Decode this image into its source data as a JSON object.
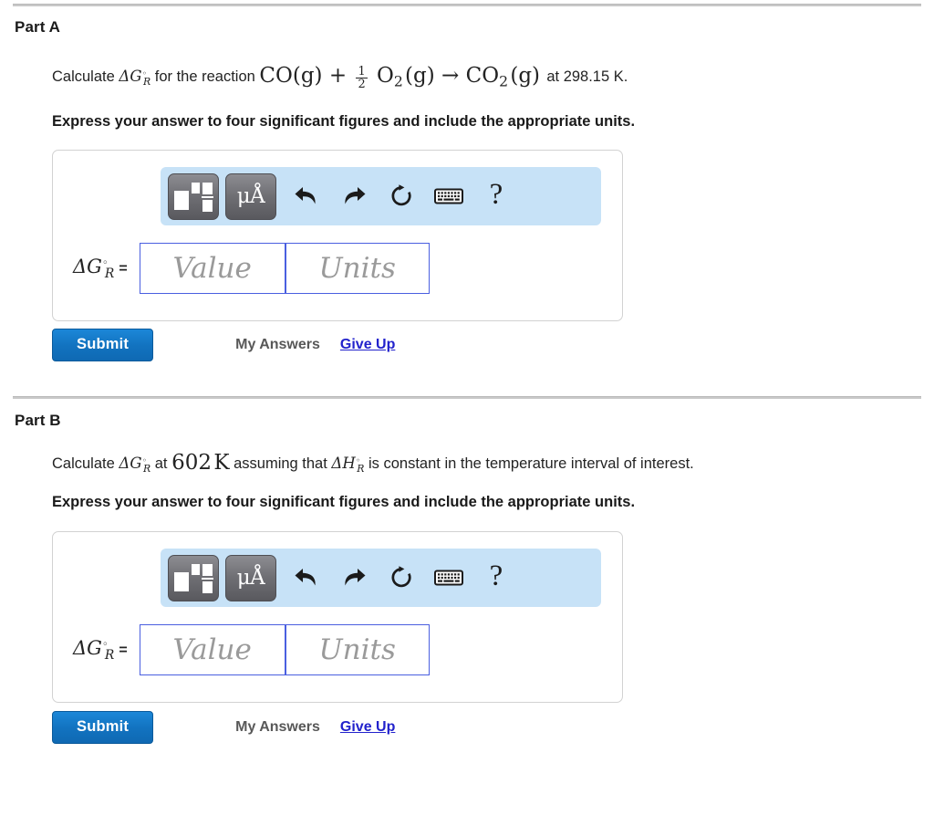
{
  "separators": {
    "count": 2,
    "color": "#c9c9c9"
  },
  "parts": [
    {
      "heading": "Part A",
      "question_prefix": "Calculate",
      "question_symbol_G": "ΔG",
      "question_mid": "for the reaction",
      "reaction": "CO(g) + 1/2 O2(g) → CO2(g)",
      "reaction_species_1": "CO",
      "reaction_state_1": "(g)",
      "plus": "+",
      "fraction_numerator": "1",
      "fraction_denominator": "2",
      "reaction_species_2": "O",
      "reaction_subscript_2": "2",
      "reaction_state_2": "(g)",
      "arrow": "→",
      "reaction_species_3": "CO",
      "reaction_subscript_3": "2",
      "reaction_state_3": "(g)",
      "question_suffix": "at 298.15 K.",
      "temperature": "298.15",
      "temperature_unit": "K",
      "instruction": "Express your answer to four significant figures and include the appropriate units.",
      "answer_label_main": "ΔG",
      "answer_label_degree": "◦",
      "answer_label_sub": "R",
      "answer_label_equals": "=",
      "value_placeholder": "Value",
      "units_placeholder": "Units",
      "value_current": "",
      "units_current": "",
      "submit_label": "Submit",
      "my_answers_label": "My Answers",
      "give_up_label": "Give Up"
    },
    {
      "heading": "Part B",
      "question_prefix": "Calculate",
      "question_symbol_G": "ΔG",
      "question_at": "at",
      "temperature": "602",
      "temperature_unit": "K",
      "question_assuming": "assuming that",
      "question_symbol_H": "ΔH",
      "question_tail": "is constant in the temperature interval of interest.",
      "instruction": "Express your answer to four significant figures and include the appropriate units.",
      "answer_label_main": "ΔG",
      "answer_label_degree": "◦",
      "answer_label_sub": "R",
      "answer_label_equals": "=",
      "value_placeholder": "Value",
      "units_placeholder": "Units",
      "value_current": "",
      "units_current": "",
      "submit_label": "Submit",
      "my_answers_label": "My Answers",
      "give_up_label": "Give Up"
    }
  ],
  "toolbar": {
    "background_color": "#c7e2f7",
    "buttons": [
      {
        "name": "template-icon",
        "label": ""
      },
      {
        "name": "greek-units-icon",
        "label": "μÅ"
      },
      {
        "name": "undo-icon",
        "label": ""
      },
      {
        "name": "redo-icon",
        "label": ""
      },
      {
        "name": "reset-icon",
        "label": ""
      },
      {
        "name": "keyboard-icon",
        "label": ""
      },
      {
        "name": "help-icon",
        "label": "?"
      }
    ],
    "help_glyph": "?"
  },
  "colors": {
    "submit_blue": "#1273c0",
    "link_blue": "#2222cc",
    "field_border": "#4a5fe0",
    "toolbar_blue": "#c7e2f7",
    "panel_border": "#d2d2d2"
  }
}
